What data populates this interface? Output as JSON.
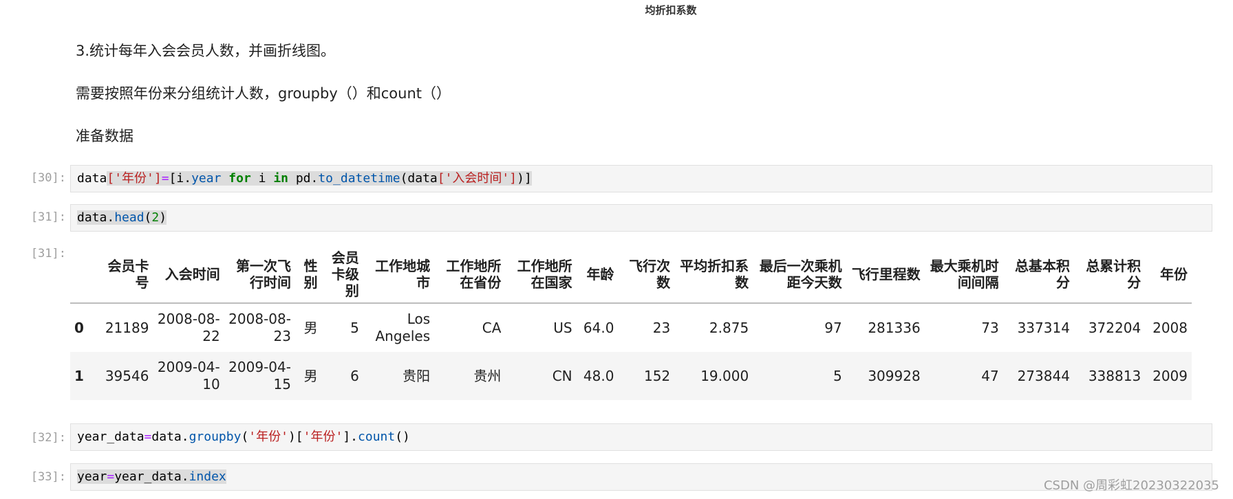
{
  "top_caption": "均折扣系数",
  "markdown": {
    "line1": "3.统计每年入会会员人数，并画折线图。",
    "line2": "需要按照年份来分组统计人数，groupby（）和count（）",
    "line3": "准备数据"
  },
  "cells": {
    "c30": {
      "prompt": "[30]:",
      "t1": "data",
      "t2": "['年份']",
      "t3": "=",
      "t4": "[i.",
      "t5": "year",
      "t6": " for ",
      "t7": "i ",
      "t8": "in ",
      "t9": "pd.",
      "t10": "to_datetime",
      "t11": "(data",
      "t12": "['入会时间']",
      "t13": ")]"
    },
    "c31": {
      "prompt": "[31]:",
      "t1": "data.",
      "t2": "head",
      "t3": "(",
      "t4": "2",
      "t5": ")"
    },
    "c31_out": {
      "prompt": "[31]:"
    },
    "c32": {
      "prompt": "[32]:",
      "t1": "year_data",
      "t2": "=",
      "t3": "data.",
      "t4": "groupby",
      "t5": "(",
      "t6": "'年份'",
      "t7": ")[",
      "t8": "'年份'",
      "t9": "].",
      "t10": "count",
      "t11": "()"
    },
    "c33": {
      "prompt": "[33]:",
      "t1": "year",
      "t2": "=",
      "t3": "year_data.",
      "t4": "index"
    }
  },
  "table": {
    "headers": [
      "",
      "会员卡号",
      "入会时间",
      "第一次飞行时间",
      "性别",
      "会员卡级别",
      "工作地城市",
      "工作地所在省份",
      "工作地所在国家",
      "年龄",
      "飞行次数",
      "平均折扣系数",
      "最后一次乘机距今天数",
      "飞行里程数",
      "最大乘机时间间隔",
      "总基本积分",
      "总累计积分",
      "年份"
    ],
    "rows": [
      [
        "0",
        "21189",
        "2008-08-22",
        "2008-08-23",
        "男",
        "5",
        "Los Angeles",
        "CA",
        "US",
        "64.0",
        "23",
        "2.875",
        "97",
        "281336",
        "73",
        "337314",
        "372204",
        "2008"
      ],
      [
        "1",
        "39546",
        "2009-04-10",
        "2009-04-15",
        "男",
        "6",
        "贵阳",
        "贵州",
        "CN",
        "48.0",
        "152",
        "19.000",
        "5",
        "309928",
        "47",
        "273844",
        "338813",
        "2009"
      ]
    ]
  },
  "watermark": "CSDN @周彩虹20230322035"
}
